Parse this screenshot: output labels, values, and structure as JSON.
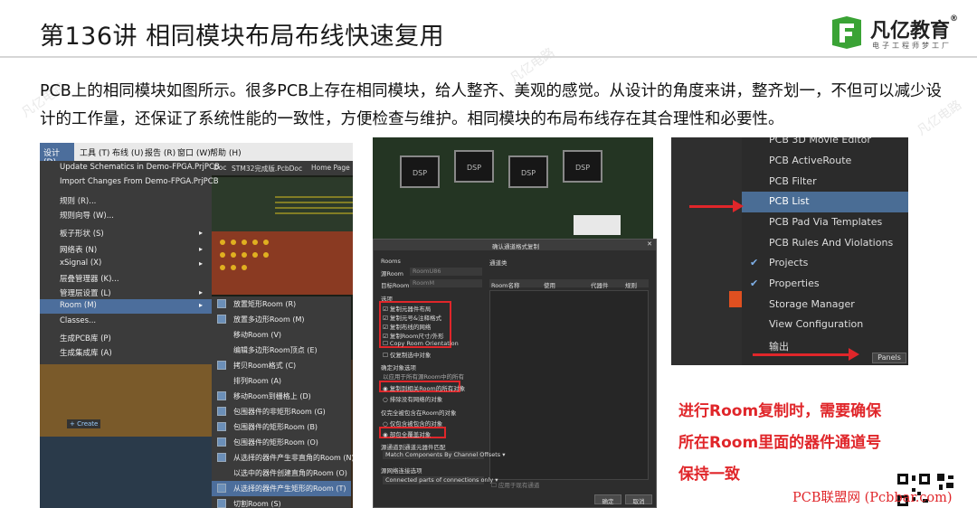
{
  "title": "第136讲 相同模块布局布线快速复用",
  "logo": {
    "name": "凡亿教育",
    "reg": "®",
    "tagline": "电子工程师梦工厂"
  },
  "intro": "PCB上的相同模块如图所示。很多PCB上存在相同模块，给人整齐、美观的感觉。从设计的角度来讲，整齐划一，不但可以减少设计的工作量，还保证了系统性能的一致性，方便检查与维护。相同模块的布局布线存在其合理性和必要性。",
  "menubar": [
    "设计 (D)",
    "工具 (T)",
    "布线 (U)",
    "报告 (R)",
    "窗口 (W)",
    "帮助 (H)"
  ],
  "design_menu": [
    "Update Schematics in Demo-FPGA.PrjPCB",
    "Import Changes From Demo-FPGA.PrjPCB",
    "规则 (R)...",
    "规则向导 (W)...",
    "板子形状 (S)",
    "网络表 (N)",
    "xSignal (X)",
    "层叠管理器 (K)...",
    "管理层设置 (L)",
    "Room (M)",
    "Classes...",
    "生成PCB库 (P)",
    "生成集成库 (A)"
  ],
  "doc_tabs": [
    "Doc",
    "STM32完成版.PcbDoc",
    "Home Page"
  ],
  "create_label": "+ Create",
  "room_menu": [
    "放置矩形Room (R)",
    "放置多边形Room (M)",
    "移动Room (V)",
    "编辑多边形Room顶点 (E)",
    "拷贝Room格式 (C)",
    "排列Room (A)",
    "移动Room到栅格上 (D)",
    "包围器件的非矩形Room (G)",
    "包围器件的矩形Room (B)",
    "包围器件的矩形Room (O)",
    "从选择的器件产生非直角的Room (N)",
    "以选中的器件创建直角的Room (O)",
    "从选择的器件产生矩形的Room (T)",
    "切割Room (S)"
  ],
  "chip_labels": [
    "DSP",
    "DSP",
    "DSP",
    "DSP"
  ],
  "dialog": {
    "title": "确认通道格式复制",
    "rooms": "Rooms",
    "src_room": "源Room",
    "src_room_val": "RoomU86",
    "dst_room": "目标Room",
    "dst_room_val": "RoomM",
    "channel": "通道类",
    "cols": [
      "Room名称",
      "使用",
      "代器件",
      "规则"
    ],
    "options": "选项",
    "opts": [
      "复制元器件布局",
      "复制元号&注释格式",
      "复制布线的网络",
      "复制Room尺寸/外形",
      "Copy Room Orientation"
    ],
    "only_sel": "仅复制选中对象",
    "apply_hdr": "确定对象选项",
    "apply_note": "以应用于所有源Room中的所有",
    "apply_a": "复制到相关Room的所有对象",
    "apply_b": "排除没有网络的对象",
    "partial_hdr": "仅完全被包含在Room的对象",
    "partial_a": "仅包含被包含的对象",
    "partial_b": "部包全覆盖对象",
    "match_hdr": "源通道到通道元器件匹配",
    "match_val": "Match Components By Channel Offsets",
    "conn_hdr": "源网络连接选项",
    "conn_val": "Connected parts of connections only",
    "apply_open": "应用于现有通道",
    "ok": "确定",
    "cancel": "取消"
  },
  "panels_menu": [
    {
      "label": "PCB 3D Movie Editor",
      "checked": false,
      "selected": false
    },
    {
      "label": "PCB ActiveRoute",
      "checked": false,
      "selected": false
    },
    {
      "label": "PCB Filter",
      "checked": false,
      "selected": false
    },
    {
      "label": "PCB List",
      "checked": false,
      "selected": true
    },
    {
      "label": "PCB Pad Via Templates",
      "checked": false,
      "selected": false
    },
    {
      "label": "PCB Rules And Violations",
      "checked": false,
      "selected": false
    },
    {
      "label": "Projects",
      "checked": true,
      "selected": false
    },
    {
      "label": "Properties",
      "checked": true,
      "selected": false
    },
    {
      "label": "Storage Manager",
      "checked": false,
      "selected": false
    },
    {
      "label": "View Configuration",
      "checked": false,
      "selected": false
    },
    {
      "label": "输出",
      "checked": false,
      "selected": false
    }
  ],
  "panels_button": "Panels",
  "note_lines": [
    "进行Room复制时，需要确保",
    "所在Room里面的器件通道号",
    "保持一致"
  ],
  "footer": "PCB联盟网 (Pcbbar.com)",
  "watermark": "凡亿电路",
  "colors": {
    "accent_red": "#e0262a",
    "logo_green": "#3aa335",
    "menu_highlight": "#4c6e9c"
  }
}
